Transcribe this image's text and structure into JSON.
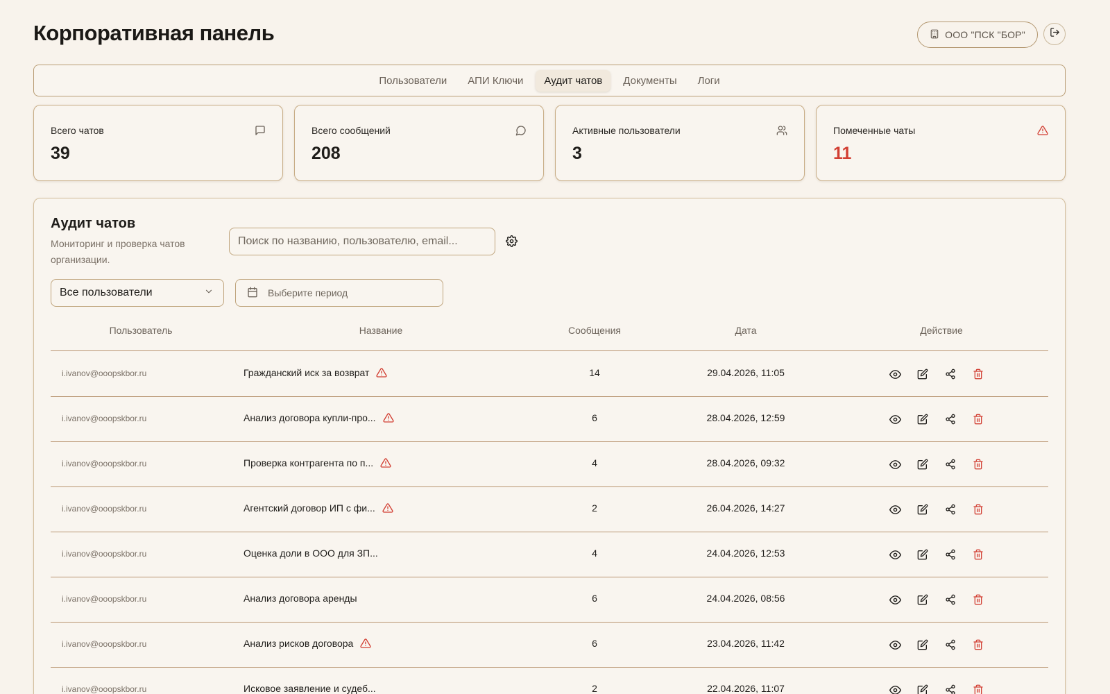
{
  "header": {
    "title": "Корпоративная панель",
    "org_label": "ООО \"ПСК \"БОР\""
  },
  "tabs": [
    {
      "label": "Пользователи",
      "active": false
    },
    {
      "label": "АПИ Ключи",
      "active": false
    },
    {
      "label": "Аудит чатов",
      "active": true
    },
    {
      "label": "Документы",
      "active": false
    },
    {
      "label": "Логи",
      "active": false
    }
  ],
  "stats": [
    {
      "label": "Всего чатов",
      "value": "39",
      "icon": "chat-square-icon"
    },
    {
      "label": "Всего сообщений",
      "value": "208",
      "icon": "message-circle-icon"
    },
    {
      "label": "Активные пользователи",
      "value": "3",
      "icon": "users-icon"
    },
    {
      "label": "Помеченные чаты",
      "value": "11",
      "icon": "alert-triangle-icon",
      "highlight": "#d23f33"
    }
  ],
  "audit": {
    "title": "Аудит чатов",
    "description": "Мониторинг и проверка чатов организации.",
    "search_placeholder": "Поиск по названию, пользователю, email...",
    "user_filter": "Все пользователи",
    "period_placeholder": "Выберите период"
  },
  "table": {
    "columns": [
      "Пользователь",
      "Название",
      "Сообщения",
      "Дата",
      "Действие"
    ],
    "rows": [
      {
        "email": "i.ivanov@ooopskbor.ru",
        "title": "Гражданский иск за возврат",
        "flagged": true,
        "messages": "14",
        "date": "29.04.2026, 11:05"
      },
      {
        "email": "i.ivanov@ooopskbor.ru",
        "title": "Анализ договора купли-про...",
        "flagged": true,
        "messages": "6",
        "date": "28.04.2026, 12:59"
      },
      {
        "email": "i.ivanov@ooopskbor.ru",
        "title": "Проверка контрагента по п...",
        "flagged": true,
        "messages": "4",
        "date": "28.04.2026, 09:32"
      },
      {
        "email": "i.ivanov@ooopskbor.ru",
        "title": "Агентский договор ИП с фи...",
        "flagged": true,
        "messages": "2",
        "date": "26.04.2026, 14:27"
      },
      {
        "email": "i.ivanov@ooopskbor.ru",
        "title": "Оценка доли в ООО для ЗП...",
        "flagged": false,
        "messages": "4",
        "date": "24.04.2026, 12:53"
      },
      {
        "email": "i.ivanov@ooopskbor.ru",
        "title": "Анализ договора аренды",
        "flagged": false,
        "messages": "6",
        "date": "24.04.2026, 08:56"
      },
      {
        "email": "i.ivanov@ooopskbor.ru",
        "title": "Анализ рисков договора",
        "flagged": true,
        "messages": "6",
        "date": "23.04.2026, 11:42"
      },
      {
        "email": "i.ivanov@ooopskbor.ru",
        "title": "Исковое заявление и судеб...",
        "flagged": false,
        "messages": "2",
        "date": "22.04.2026, 11:07"
      }
    ]
  },
  "colors": {
    "background": "#f8f3ec",
    "border": "#b89c74",
    "danger": "#d23f33"
  }
}
